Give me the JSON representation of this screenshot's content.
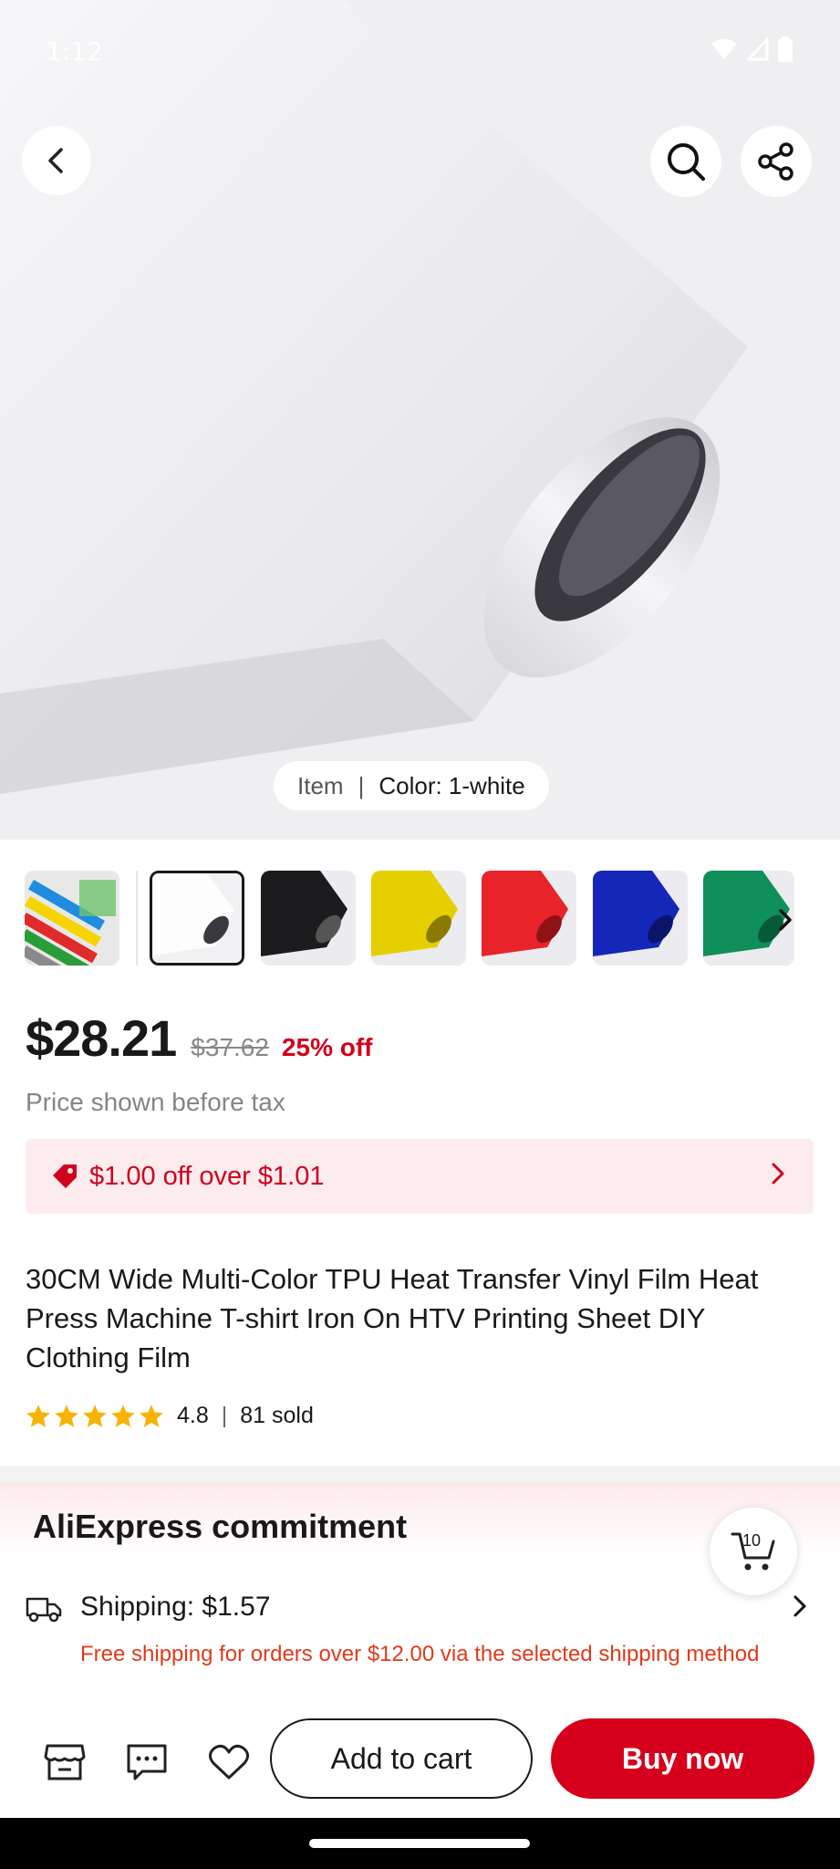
{
  "status_bar": {
    "time": "1:12"
  },
  "hero": {
    "item_label": "Item",
    "color_label": "Color: 1-white"
  },
  "thumbnails": [
    {
      "name": "multi-color",
      "colors": [
        "#1f8ce0",
        "#f5d400",
        "#e02b2b",
        "#2a9d3a",
        "#8a8a8a"
      ]
    },
    {
      "name": "white",
      "color": "#f2f2f2",
      "selected": true
    },
    {
      "name": "black",
      "color": "#222222"
    },
    {
      "name": "yellow",
      "color": "#e6cf00"
    },
    {
      "name": "red",
      "color": "#e8232a"
    },
    {
      "name": "blue",
      "color": "#1427b8"
    },
    {
      "name": "green",
      "color": "#0f8f5a"
    }
  ],
  "price": {
    "current": "$28.21",
    "original": "$37.62",
    "discount": "25% off",
    "tax_note": "Price shown before tax"
  },
  "coupon": {
    "text": "$1.00 off over $1.01"
  },
  "product": {
    "title": "30CM Wide Multi-Color TPU Heat Transfer Vinyl Film Heat Press Machine T-shirt Iron On HTV Printing Sheet DIY Clothing Film",
    "rating": "4.8",
    "sold": "81 sold"
  },
  "commitment": {
    "title": "AliExpress commitment",
    "cart_count": "10",
    "shipping_label": "Shipping: $1.57",
    "shipping_note": "Free shipping for orders over $12.00 via the selected shipping method"
  },
  "bottom_bar": {
    "add_to_cart": "Add to cart",
    "buy_now": "Buy now"
  },
  "colors": {
    "accent_red": "#d6001c",
    "note_orange": "#e03a1b",
    "star_yellow": "#f8b300"
  }
}
